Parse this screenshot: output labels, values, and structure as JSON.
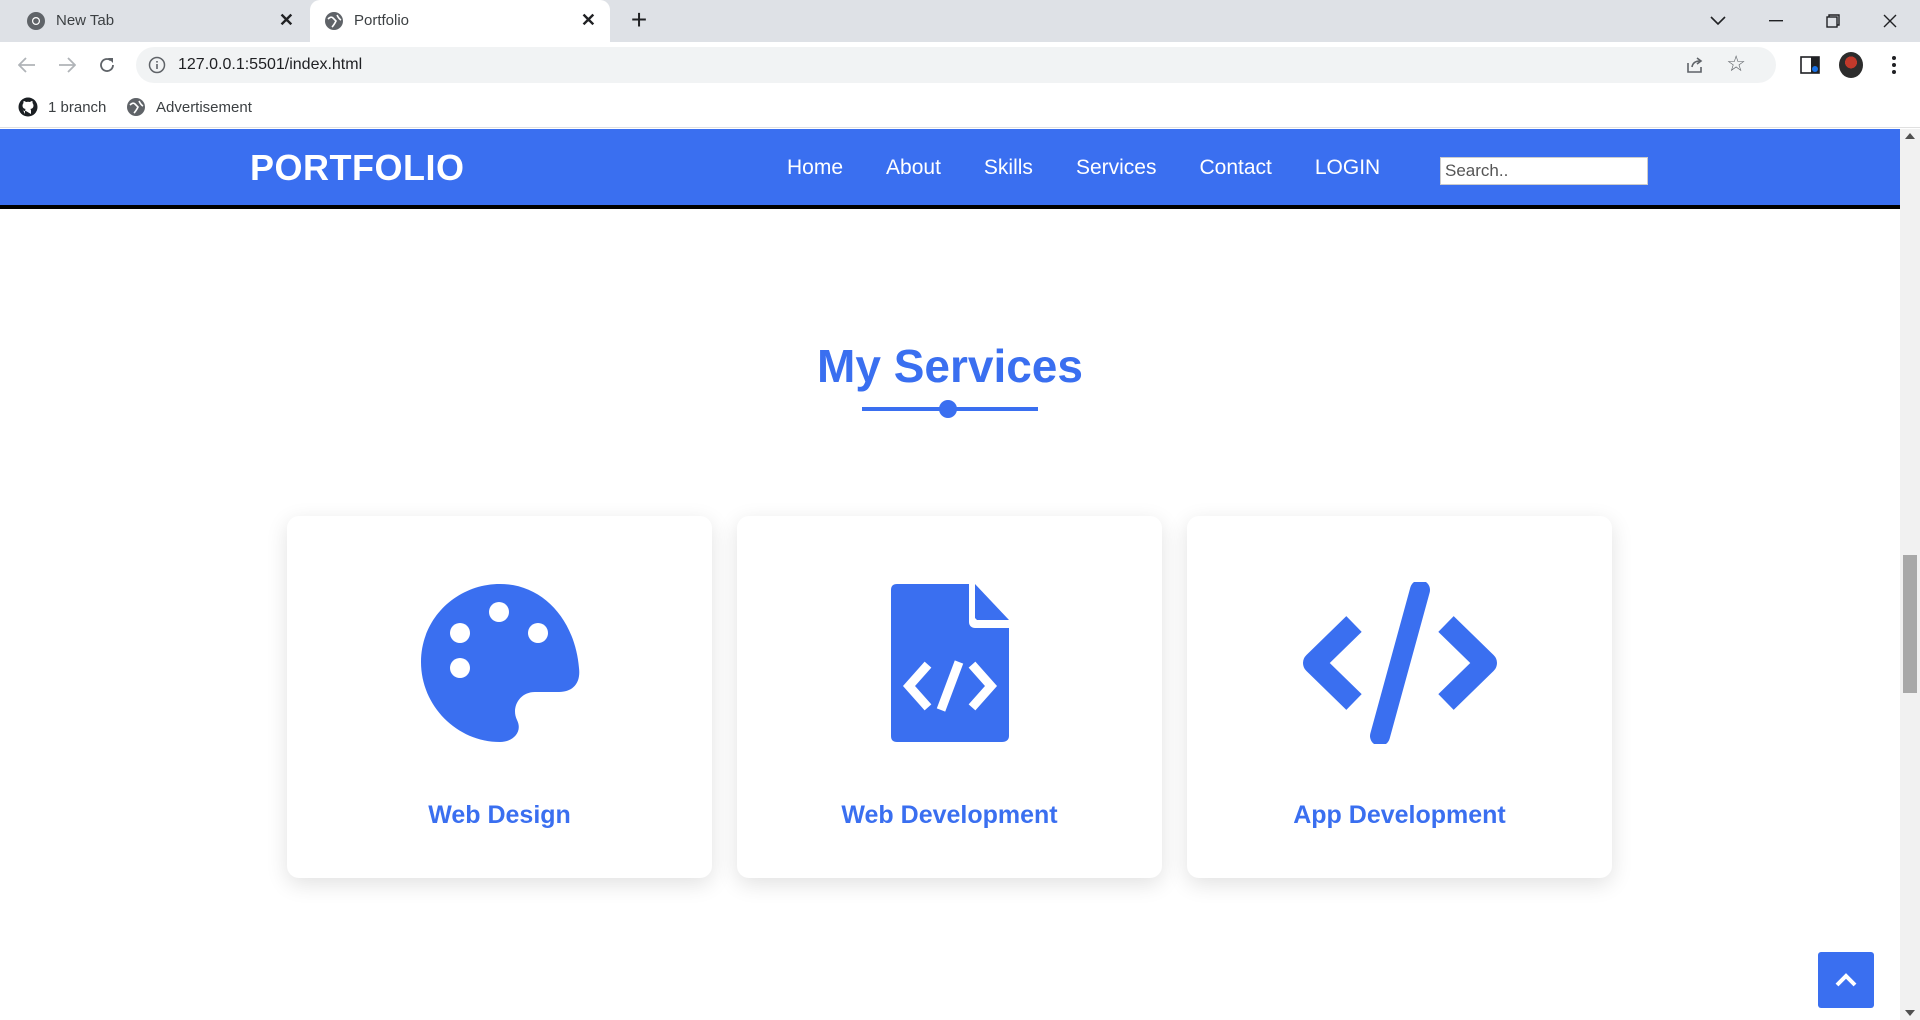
{
  "browser": {
    "tabs": [
      {
        "title": "New Tab",
        "icon": "chrome-icon",
        "active": false
      },
      {
        "title": "Portfolio",
        "icon": "globe-icon",
        "active": true
      }
    ],
    "url": "127.0.0.1:5501/index.html",
    "bookmarks": [
      {
        "label": "1 branch",
        "icon": "github-icon"
      },
      {
        "label": "Advertisement",
        "icon": "globe-icon"
      }
    ]
  },
  "navbar": {
    "logo": "PORTFOLIO",
    "links": [
      "Home",
      "About",
      "Skills",
      "Services",
      "Contact",
      "LOGIN"
    ],
    "search_placeholder": "Search.."
  },
  "services": {
    "title": "My Services",
    "cards": [
      {
        "label": "Web Design",
        "icon": "palette-icon"
      },
      {
        "label": "Web Development",
        "icon": "file-code-icon"
      },
      {
        "label": "App Development",
        "icon": "code-icon"
      }
    ]
  },
  "colors": {
    "accent": "#3a6ff0",
    "navbar_border": "#000000",
    "tabbar": "#dee1e6"
  }
}
